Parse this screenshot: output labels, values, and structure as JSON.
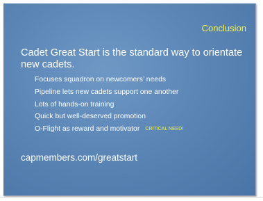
{
  "slide": {
    "title": "Conclusion",
    "lead": "Cadet Great Start is the standard way to orientate new cadets.",
    "bullets": [
      "Focuses squadron on newcomers’ needs",
      "Pipeline lets new cadets support one another",
      "Lots of hands-on training",
      "Quick but well-deserved promotion",
      "O-Flight as reward and motivator"
    ],
    "critical_note": "CRITICAL NEED!",
    "url": "capmembers.com/greatstart"
  },
  "colors": {
    "background": "#5b86b6",
    "title": "#f3f34a",
    "text": "#ffffff"
  }
}
